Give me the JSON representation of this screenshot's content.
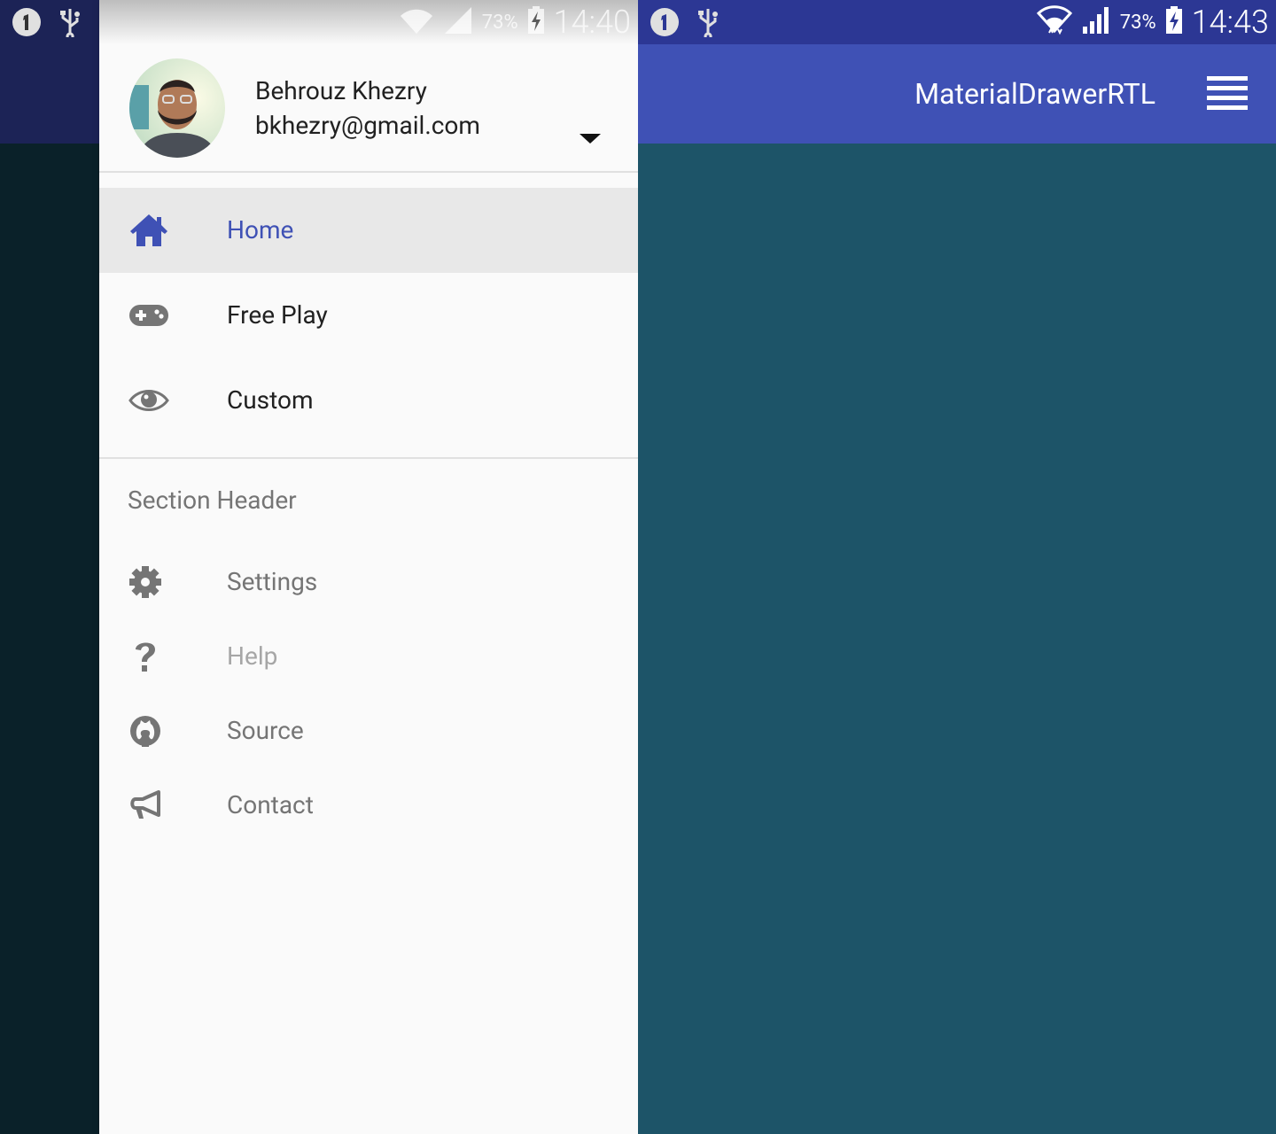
{
  "left_screen": {
    "status_bar": {
      "battery_percent": "73%",
      "time": "14:40",
      "notification_icons": [
        "sim-1-icon",
        "usb-icon"
      ]
    },
    "drawer": {
      "account": {
        "name": "Behrouz Khezry",
        "email": "bkhezry@gmail.com"
      },
      "primary_items": [
        {
          "label": "Home",
          "icon": "home-icon",
          "selected": true
        },
        {
          "label": "Free Play",
          "icon": "gamepad-icon",
          "selected": false
        },
        {
          "label": "Custom",
          "icon": "eye-icon",
          "selected": false
        }
      ],
      "section_header": "Section Header",
      "secondary_items": [
        {
          "label": "Settings",
          "icon": "gear-icon",
          "enabled": true
        },
        {
          "label": "Help",
          "icon": "question-icon",
          "enabled": false
        },
        {
          "label": "Source",
          "icon": "github-icon",
          "enabled": true
        },
        {
          "label": "Contact",
          "icon": "megaphone-icon",
          "enabled": true
        }
      ]
    }
  },
  "right_screen": {
    "status_bar": {
      "battery_percent": "73%",
      "time": "14:43",
      "notification_icons": [
        "sim-1-icon",
        "usb-icon"
      ]
    },
    "toolbar": {
      "title": "MaterialDrawerRTL",
      "menu_icon": "hamburger-menu-icon"
    }
  },
  "colors": {
    "primary": "#3f51b5",
    "primary_dark": "#2c3794",
    "selected_text": "#3f51b5",
    "content_background": "#1d5468"
  }
}
